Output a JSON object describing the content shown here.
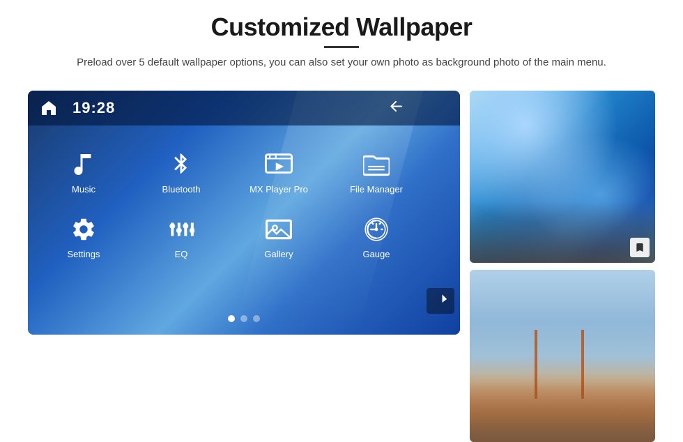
{
  "header": {
    "title": "Customized Wallpaper",
    "subtitle": "Preload over 5 default wallpaper options, you can also set your own photo as background photo of the main menu."
  },
  "screen": {
    "time": "19:28",
    "apps_row1": [
      {
        "id": "music",
        "label": "Music"
      },
      {
        "id": "bluetooth",
        "label": "Bluetooth"
      },
      {
        "id": "mxplayer",
        "label": "MX Player Pro"
      },
      {
        "id": "filemanager",
        "label": "File Manager"
      }
    ],
    "apps_row2": [
      {
        "id": "settings",
        "label": "Settings"
      },
      {
        "id": "eq",
        "label": "EQ"
      },
      {
        "id": "gallery",
        "label": "Gallery"
      },
      {
        "id": "gauge",
        "label": "Gauge"
      }
    ],
    "dots": [
      {
        "active": true
      },
      {
        "active": false
      },
      {
        "active": false
      }
    ]
  },
  "wallpapers": {
    "top_alt": "Ice cave wallpaper",
    "bottom_alt": "Golden Gate Bridge wallpaper"
  }
}
